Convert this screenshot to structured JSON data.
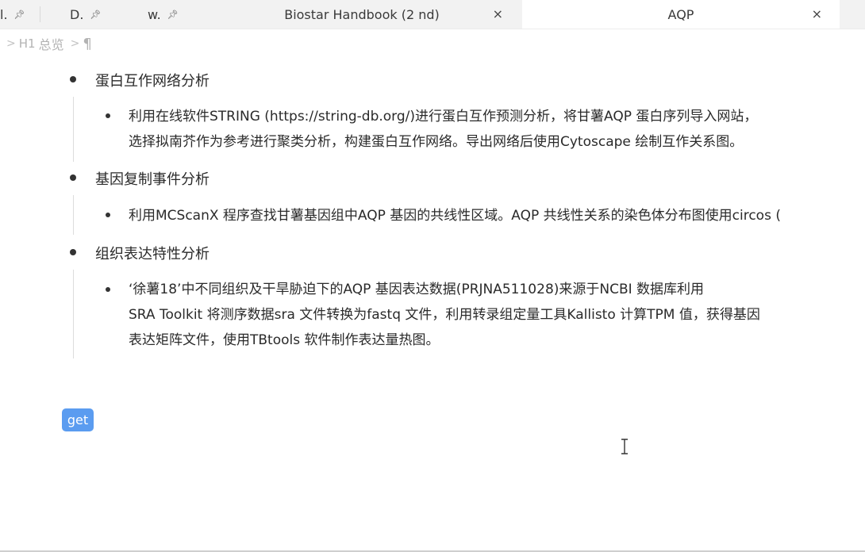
{
  "tabs": [
    {
      "label": "l.",
      "pinned": true
    },
    {
      "label": "D.",
      "pinned": true
    },
    {
      "label": "w.",
      "pinned": true
    },
    {
      "label": "Biostar Handbook (2 nd)",
      "close": "×"
    },
    {
      "label": "AQP",
      "close": "×",
      "active": true
    }
  ],
  "icons": {
    "pin": "pin-icon",
    "close": "close-icon",
    "chevron": "chevron-right-icon",
    "pilcrow": "pilcrow-icon",
    "cursor": "text-cursor-icon"
  },
  "breadcrumb": {
    "h1_icon": "H1",
    "title": "总览",
    "pilcrow": "¶"
  },
  "sections": [
    {
      "heading": "蛋白互作网络分析",
      "items": [
        "利用在线软件STRING (https://string-db.org/)进行蛋白互作预测分析，将甘薯AQP 蛋白序列导入网站，\n选择拟南芥作为参考进行聚类分析，构建蛋白互作网络。导出网络后使用Cytoscape 绘制互作关系图。"
      ]
    },
    {
      "heading": "基因复制事件分析",
      "items": [
        "利用MCScanX 程序查找甘薯基因组中AQP 基因的共线性区域。AQP 共线性关系的染色体分布图使用circos ("
      ]
    },
    {
      "heading": "组织表达特性分析",
      "items": [
        "‘徐薯18’中不同组织及干旱胁迫下的AQP 基因表达数据(PRJNA511028)来源于NCBI 数据库利用\nSRA Toolkit 将测序数据sra 文件转换为fastq 文件，利用转录组定量工具Kallisto 计算TPM 值，获得基因\n表达矩阵文件，使用TBtools 软件制作表达量热图。"
      ]
    }
  ],
  "get_button": "get",
  "colors": {
    "accent": "#5b9cf0",
    "tabbar": "#f2f2f2",
    "text": "#2a2a2a"
  }
}
